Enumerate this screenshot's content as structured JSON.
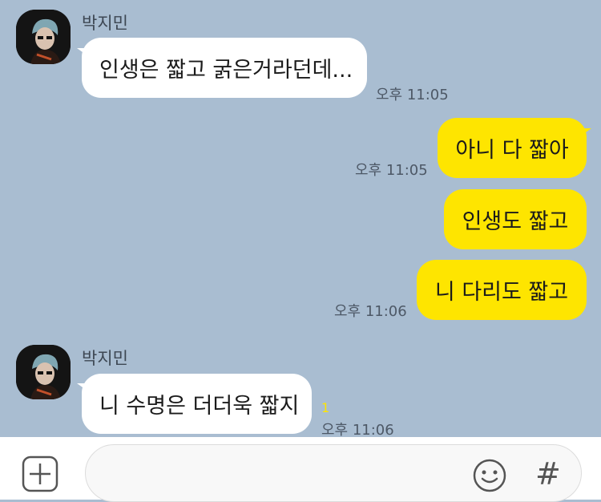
{
  "messages": [
    {
      "sender": "박지민",
      "direction": "in",
      "text": "인생은 짧고 굵은거라던데...",
      "time": "오후 11:05"
    },
    {
      "direction": "out",
      "text": "아니 다 짧아",
      "time": "오후 11:05"
    },
    {
      "direction": "out",
      "text": "인생도 짧고",
      "time": ""
    },
    {
      "direction": "out",
      "text": "니 다리도 짧고",
      "time": "오후 11:06"
    },
    {
      "sender": "박지민",
      "direction": "in",
      "text": "니 수명은 더더욱 짧지",
      "time": "오후 11:06",
      "unread": "1"
    }
  ],
  "composer": {
    "plus_icon": "plus-square-icon",
    "emoji_icon": "smiley-icon",
    "hash_symbol": "#"
  },
  "colors": {
    "background": "#a9bdd1",
    "incoming_bubble": "#ffffff",
    "outgoing_bubble": "#fee500",
    "unread_count": "#fee500"
  }
}
